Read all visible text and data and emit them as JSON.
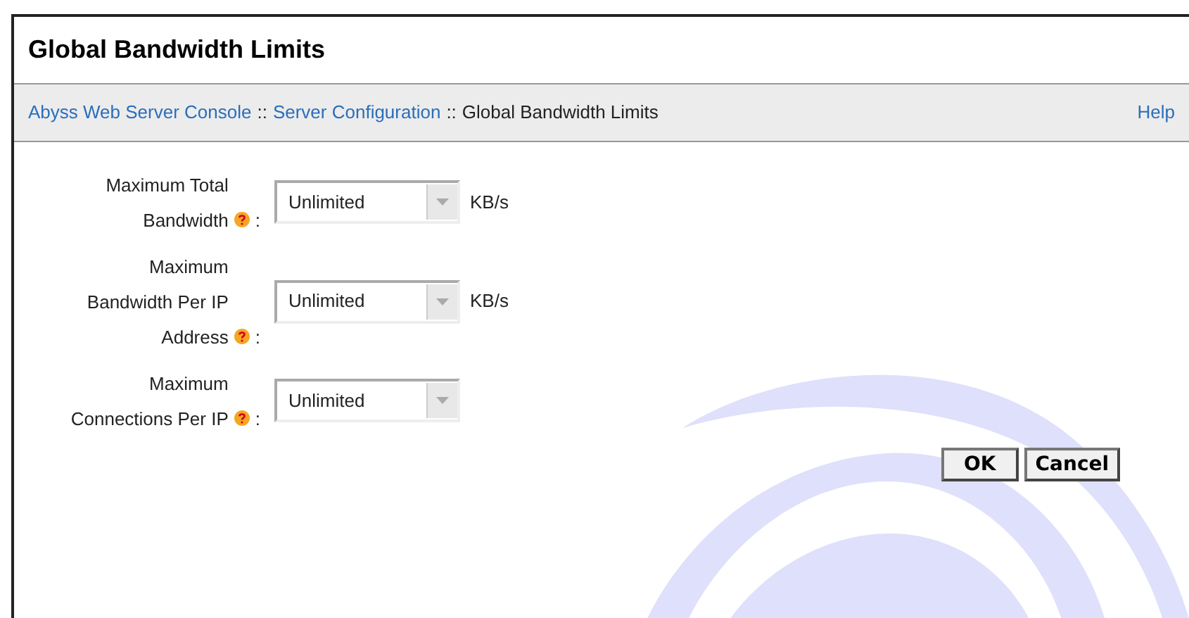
{
  "window": {
    "title": "Global Bandwidth Limits"
  },
  "breadcrumb": [
    {
      "text": "Abyss Web Server Console",
      "kind": "link"
    },
    {
      "text": "::",
      "kind": "separator"
    },
    {
      "text": "Server Configuration",
      "kind": "link"
    },
    {
      "text": "::",
      "kind": "separator"
    },
    {
      "text": "Global Bandwidth Limits",
      "kind": "current"
    }
  ],
  "help_link": "Help",
  "fields": [
    {
      "label": "Maximum Total Bandwidth",
      "colon": ":",
      "value": "Unlimited",
      "unit": "KB/s"
    },
    {
      "label": "Maximum Bandwidth Per IP Address",
      "colon": ":",
      "value": "Unlimited",
      "unit": "KB/s"
    },
    {
      "label": "Maximum Connections Per IP",
      "colon": ":",
      "value": "Unlimited"
    }
  ],
  "buttons": [
    "OK",
    "Cancel"
  ]
}
